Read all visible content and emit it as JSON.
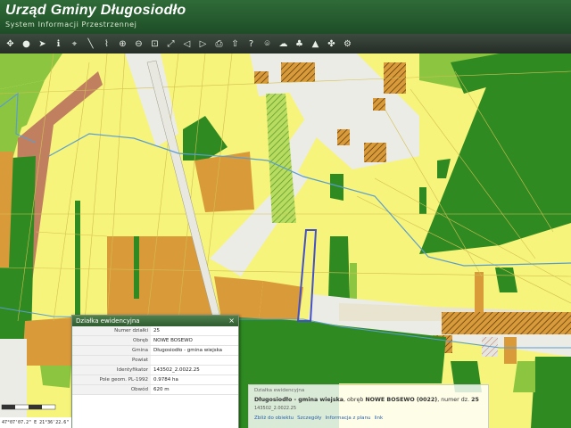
{
  "header": {
    "title": "Urząd Gminy Długosiodło",
    "subtitle": "System Informacji Przestrzennej"
  },
  "toolbar": {
    "tools": [
      {
        "name": "pan-icon",
        "glyph": "✥"
      },
      {
        "name": "globe-icon",
        "glyph": "●"
      },
      {
        "name": "select-arrow-icon",
        "glyph": "➤"
      },
      {
        "name": "info-icon",
        "glyph": "ℹ"
      },
      {
        "name": "measure-icon",
        "glyph": "⌖"
      },
      {
        "name": "ruler-icon",
        "glyph": "╲"
      },
      {
        "name": "area-icon",
        "glyph": "⌇"
      },
      {
        "name": "zoom-in-icon",
        "glyph": "⊕"
      },
      {
        "name": "zoom-out-icon",
        "glyph": "⊖"
      },
      {
        "name": "zoom-box-icon",
        "glyph": "⊡"
      },
      {
        "name": "full-extent-icon",
        "glyph": "⤢"
      },
      {
        "name": "back-icon",
        "glyph": "◁"
      },
      {
        "name": "forward-icon",
        "glyph": "▷"
      },
      {
        "name": "print-icon",
        "glyph": "⎙"
      },
      {
        "name": "upload-icon",
        "glyph": "⇧"
      },
      {
        "name": "help-icon",
        "glyph": "?"
      },
      {
        "name": "location-icon",
        "glyph": "⌾"
      },
      {
        "name": "cloud-icon",
        "glyph": "☁"
      },
      {
        "name": "tree-icon",
        "glyph": "♣"
      },
      {
        "name": "triangle-icon",
        "glyph": "▲"
      },
      {
        "name": "layers-icon",
        "glyph": "✤"
      },
      {
        "name": "settings-icon",
        "glyph": "⚙"
      }
    ]
  },
  "popup": {
    "title": "Działka ewidencyjna",
    "close": "×",
    "rows": [
      {
        "key": "Numer działki",
        "value": "25"
      },
      {
        "key": "Obręb",
        "value": "NOWE BOSEWO"
      },
      {
        "key": "Gmina",
        "value": "Długosiodło - gmina wiejska"
      },
      {
        "key": "Powiat",
        "value": ""
      },
      {
        "key": "Identyfikator",
        "value": "143502_2.0022.25"
      },
      {
        "key": "Pole geom. PL-1992",
        "value": "0.9784 ha"
      },
      {
        "key": "Obwód",
        "value": "620 m"
      }
    ]
  },
  "info": {
    "header": "Działka ewidencyjna",
    "line_prefix": "Długosiodło - gmina wiejska",
    "line_mid": ", obręb ",
    "line_obreb": "NOWE BOSEWO (0022)",
    "line_num_label": ", numer dz. ",
    "line_num": "25",
    "sub": "143502_2.0022.25",
    "links": [
      "Zbliż do obiektu",
      "Szczegóły",
      "Informacja z planu",
      "link"
    ]
  },
  "coords": "47°07'07.2\" E 21°36'22.6\"",
  "colors": {
    "yellow": "#f6f47a",
    "pale_yellow": "#fbfaa8",
    "forest": "#2f8a22",
    "light_green": "#8cc640",
    "orange": "#d99a3a",
    "brown": "#c08060",
    "white_parcel": "#ecece6",
    "water": "#5a9dd0",
    "parcel_line": "#c9b54a",
    "highlight": "#4350c8"
  }
}
